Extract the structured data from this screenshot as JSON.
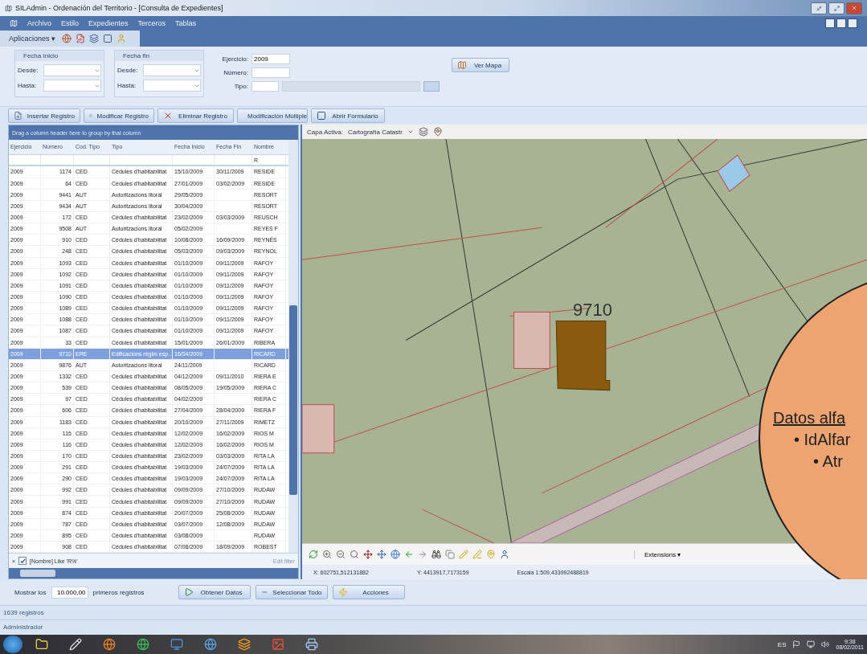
{
  "window": {
    "title": "SILAdmin  - Ordenación del Territorio - [Consulta de Expedientes]"
  },
  "menu": [
    "Archivo",
    "Estilo",
    "Expedientes",
    "Terceros",
    "Tablas"
  ],
  "toolbar": {
    "apps": "Aplicaciones ▾"
  },
  "filters": {
    "fecha_inicio": {
      "title": "Fecha Inicio",
      "desde": "Desde:",
      "hasta": "Hasta:"
    },
    "fecha_fin": {
      "title": "Fecha fin",
      "desde": "Desde:",
      "hasta": "Hasta:"
    },
    "ejercicio": {
      "label": "Ejercicio:",
      "value": "2009"
    },
    "numero": {
      "label": "Número:"
    },
    "tipo": {
      "label": "Tipo:"
    },
    "ver_mapa": "Ver Mapa"
  },
  "actions": [
    {
      "kind": "insert",
      "label": "Insertar Registro"
    },
    {
      "kind": "edit",
      "label": "Modificar Registro"
    },
    {
      "kind": "delete",
      "label": "Eliminar Registro"
    },
    {
      "kind": "multi",
      "label": "Modificación Múltiple"
    },
    {
      "kind": "form",
      "label": "Abrir Formulario"
    }
  ],
  "grid": {
    "group_hint": "Drag a column header here to group by that column",
    "columns": [
      "Ejercicio",
      "Número",
      "Cod. Tipo",
      "Tipo",
      "Fecha Inicio",
      "Fecha Fin",
      "Nombre"
    ],
    "name_filter": "R",
    "rows": [
      {
        "selected": false,
        "cells": [
          "2009",
          "1174",
          "CED",
          "Cédules d'habitabilitat",
          "15/10/2009",
          "30/11/2009",
          "RESIDE"
        ]
      },
      {
        "selected": false,
        "cells": [
          "2009",
          "64",
          "CED",
          "Cédules d'habitabilitat",
          "27/01/2009",
          "03/02/2009",
          "RESIDE"
        ]
      },
      {
        "selected": false,
        "cells": [
          "2009",
          "9441",
          "AUT",
          "Autoritzacions litoral",
          "29/05/2009",
          "",
          "RESORT"
        ]
      },
      {
        "selected": false,
        "cells": [
          "2009",
          "9434",
          "AUT",
          "Autoritzacions litoral",
          "30/04/2009",
          "",
          "RESORT"
        ]
      },
      {
        "selected": false,
        "cells": [
          "2009",
          "172",
          "CED",
          "Cédules d'habitabilitat",
          "23/02/2009",
          "03/03/2009",
          "REUSCH"
        ]
      },
      {
        "selected": false,
        "cells": [
          "2009",
          "9508",
          "AUT",
          "Autoritzacions litoral",
          "05/02/2009",
          "",
          "REYES F"
        ]
      },
      {
        "selected": false,
        "cells": [
          "2009",
          "910",
          "CED",
          "Cédules d'habitabilitat",
          "10/08/2009",
          "16/09/2009",
          "REYNÉS"
        ]
      },
      {
        "selected": false,
        "cells": [
          "2009",
          "248",
          "CED",
          "Cédules d'habitabilitat",
          "05/03/2009",
          "09/03/2009",
          "REYNOL"
        ]
      },
      {
        "selected": false,
        "cells": [
          "2009",
          "1093",
          "CED",
          "Cédules d'habitabilitat",
          "01/10/2009",
          "09/11/2009",
          "RAFOY"
        ]
      },
      {
        "selected": false,
        "cells": [
          "2009",
          "1092",
          "CED",
          "Cédules d'habitabilitat",
          "01/10/2009",
          "09/11/2009",
          "RAFOY"
        ]
      },
      {
        "selected": false,
        "cells": [
          "2009",
          "1091",
          "CED",
          "Cédules d'habitabilitat",
          "01/10/2009",
          "09/11/2009",
          "RAFOY"
        ]
      },
      {
        "selected": false,
        "cells": [
          "2009",
          "1090",
          "CED",
          "Cédules d'habitabilitat",
          "01/10/2009",
          "09/11/2009",
          "RAFOY"
        ]
      },
      {
        "selected": false,
        "cells": [
          "2009",
          "1089",
          "CED",
          "Cédules d'habitabilitat",
          "01/10/2009",
          "09/11/2009",
          "RAFOY"
        ]
      },
      {
        "selected": false,
        "cells": [
          "2009",
          "1088",
          "CED",
          "Cédules d'habitabilitat",
          "01/10/2009",
          "09/11/2009",
          "RAFOY"
        ]
      },
      {
        "selected": false,
        "cells": [
          "2009",
          "1087",
          "CED",
          "Cédules d'habitabilitat",
          "01/10/2009",
          "09/11/2009",
          "RAFOY"
        ]
      },
      {
        "selected": false,
        "cells": [
          "2009",
          "33",
          "CED",
          "Cédules d'habitabilitat",
          "15/01/2009",
          "26/01/2009",
          "RIBERA"
        ]
      },
      {
        "selected": true,
        "cells": [
          "2009",
          "9710",
          "ERE",
          "Edificacions règim esp...",
          "16/04/2009",
          "",
          "RICARD"
        ]
      },
      {
        "selected": false,
        "cells": [
          "2009",
          "9876",
          "AUT",
          "Autoritzacions litoral",
          "24/11/2009",
          "",
          "RICARD"
        ]
      },
      {
        "selected": false,
        "cells": [
          "2009",
          "1332",
          "CED",
          "Cédules d'habitabilitat",
          "04/12/2009",
          "09/11/2010",
          "RIERA E"
        ]
      },
      {
        "selected": false,
        "cells": [
          "2009",
          "539",
          "CED",
          "Cédules d'habitabilitat",
          "08/05/2009",
          "19/05/2009",
          "RIERA C"
        ]
      },
      {
        "selected": false,
        "cells": [
          "2009",
          "97",
          "CED",
          "Cédules d'habitabilitat",
          "04/02/2009",
          "",
          "RIERA C"
        ]
      },
      {
        "selected": false,
        "cells": [
          "2009",
          "606",
          "CED",
          "Cédules d'habitabilitat",
          "27/04/2009",
          "28/04/2009",
          "RIERA F"
        ]
      },
      {
        "selected": false,
        "cells": [
          "2009",
          "1183",
          "CED",
          "Cédules d'habitabilitat",
          "20/10/2009",
          "27/11/2009",
          "RIMETZ"
        ]
      },
      {
        "selected": false,
        "cells": [
          "2009",
          "115",
          "CED",
          "Cédules d'habitabilitat",
          "12/02/2009",
          "16/02/2009",
          "RIOS M"
        ]
      },
      {
        "selected": false,
        "cells": [
          "2009",
          "116",
          "CED",
          "Cédules d'habitabilitat",
          "12/02/2009",
          "16/02/2009",
          "RIOS M"
        ]
      },
      {
        "selected": false,
        "cells": [
          "2009",
          "170",
          "CED",
          "Cédules d'habitabilitat",
          "23/02/2009",
          "03/03/2009",
          "RITA LA"
        ]
      },
      {
        "selected": false,
        "cells": [
          "2009",
          "291",
          "CED",
          "Cédules d'habitabilitat",
          "19/03/2009",
          "24/07/2009",
          "RITA LA"
        ]
      },
      {
        "selected": false,
        "cells": [
          "2009",
          "290",
          "CED",
          "Cédules d'habitabilitat",
          "19/03/2009",
          "24/07/2009",
          "RITA LA"
        ]
      },
      {
        "selected": false,
        "cells": [
          "2009",
          "992",
          "CED",
          "Cédules d'habitabilitat",
          "09/09/2009",
          "27/10/2009",
          "RUDAW"
        ]
      },
      {
        "selected": false,
        "cells": [
          "2009",
          "991",
          "CED",
          "Cédules d'habitabilitat",
          "09/09/2009",
          "27/10/2009",
          "RUDAW"
        ]
      },
      {
        "selected": false,
        "cells": [
          "2009",
          "874",
          "CED",
          "Cédules d'habitabilitat",
          "20/07/2009",
          "25/08/2009",
          "RUDAW"
        ]
      },
      {
        "selected": false,
        "cells": [
          "2009",
          "787",
          "CED",
          "Cédules d'habitabilitat",
          "03/07/2009",
          "12/08/2009",
          "RUDAW"
        ]
      },
      {
        "selected": false,
        "cells": [
          "2009",
          "895",
          "CED",
          "Cédules d'habitabilitat",
          "03/08/2009",
          "",
          "RUDAW"
        ]
      },
      {
        "selected": false,
        "cells": [
          "2009",
          "908",
          "CED",
          "Cédules d'habitabilitat",
          "07/08/2009",
          "18/09/2009",
          "ROBEST"
        ]
      }
    ],
    "filter_bar": {
      "close": "×",
      "checked": true,
      "text": "[Nombre] Like 'R%'",
      "edit": "Edit filter"
    }
  },
  "map": {
    "capa_label": "Capa Activa:",
    "capa_value": "Cartografía Catastr",
    "parcel_label": "9710",
    "extensions": "Extensions ▾",
    "x": "X: 602751,512131882",
    "y": "Y: 4413917,7173159",
    "scale": "Escala 1:509,433992488819"
  },
  "callout": {
    "heading": "Datos alfa",
    "items": [
      {
        "text": "• IdAlfar",
        "children": [
          {
            "text": "• Atr"
          }
        ]
      }
    ]
  },
  "bottom": {
    "show_label": "Mostrar los",
    "show_value": "10.000,00",
    "show_suffix": "primeros registros",
    "buttons": [
      {
        "kind": "fetch",
        "label": "Obtener Datos"
      },
      {
        "kind": "select",
        "label": "Seleccionar Todo"
      },
      {
        "kind": "actions",
        "label": "Acciones"
      }
    ]
  },
  "status": {
    "records": "1639 registros",
    "user": "Administrador"
  },
  "taskbar": {
    "lang": "ES",
    "time": "9:38",
    "date": "08/02/2011"
  }
}
